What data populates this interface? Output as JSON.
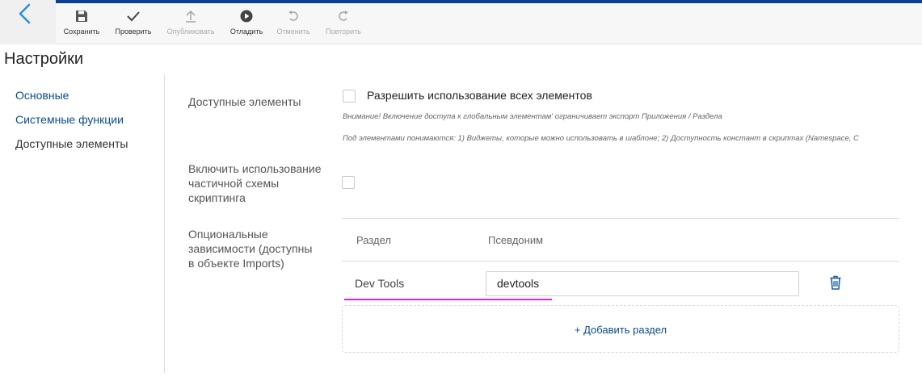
{
  "toolbar": {
    "buttons": [
      {
        "label": "Сохранить",
        "icon": "save-icon",
        "enabled": true
      },
      {
        "label": "Проверить",
        "icon": "check-icon",
        "enabled": true
      },
      {
        "label": "Опубликовать",
        "icon": "upload-icon",
        "enabled": false
      },
      {
        "label": "Отладить",
        "icon": "play-icon",
        "enabled": true
      },
      {
        "label": "Отменить",
        "icon": "undo-icon",
        "enabled": false
      },
      {
        "label": "Повторить",
        "icon": "redo-icon",
        "enabled": false
      }
    ]
  },
  "page": {
    "title": "Настройки"
  },
  "sidebar": {
    "items": [
      {
        "label": "Основные",
        "active": false
      },
      {
        "label": "Системные функции",
        "active": false
      },
      {
        "label": "Доступные элементы",
        "active": true
      }
    ]
  },
  "settings": {
    "available_elements": {
      "label": "Доступные элементы",
      "checkbox_label": "Разрешить использование всех элементов",
      "checked": false,
      "note1": "Внимание! Включение доступа к глобальным элементам' ограничивает экспорт Приложения / Раздела",
      "note2": "Под элементами понимаются: 1) Виджеты, которые можно использовать в шаблоне; 2) Доступность констант в скриптах (Namespace, C"
    },
    "partial_scripting": {
      "label_line1": "Включить использование",
      "label_line2": "частичной схемы",
      "label_line3": "скриптинга",
      "checked": false
    },
    "optional_deps": {
      "label_line1": "Опциональные",
      "label_line2": "зависимости (доступны",
      "label_line3": "в объекте Imports)",
      "columns": [
        "Раздел",
        "Псевдоним"
      ],
      "rows": [
        {
          "section": "Dev Tools",
          "alias": "devtools"
        }
      ],
      "add_label": "+ Добавить раздел"
    }
  },
  "colors": {
    "accent": "#0b3f93",
    "link": "#0b4b8f",
    "highlight": "#e020e0"
  }
}
